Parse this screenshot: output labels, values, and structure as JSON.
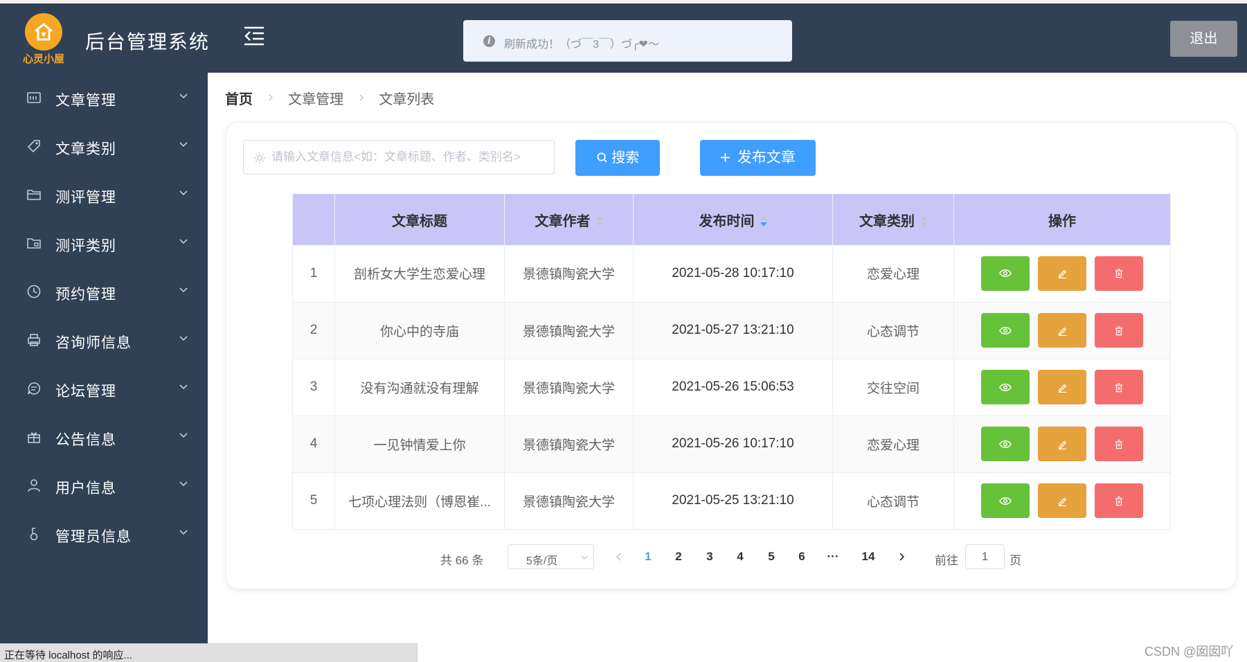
{
  "header": {
    "logo_text": "心灵小屋",
    "app_title": "后台管理系统",
    "toast_message": "刷新成功！（づ￣3￣）づ╭❤～",
    "logout_label": "退出"
  },
  "sidebar": {
    "items": [
      {
        "label": "文章管理",
        "icon": "article-icon"
      },
      {
        "label": "文章类别",
        "icon": "tag-icon"
      },
      {
        "label": "测评管理",
        "icon": "folder-icon"
      },
      {
        "label": "测评类别",
        "icon": "folder-icon"
      },
      {
        "label": "预约管理",
        "icon": "clock-icon"
      },
      {
        "label": "咨询师信息",
        "icon": "printer-icon"
      },
      {
        "label": "论坛管理",
        "icon": "chat-icon"
      },
      {
        "label": "公告信息",
        "icon": "gift-icon"
      },
      {
        "label": "用户信息",
        "icon": "user-icon"
      },
      {
        "label": "管理员信息",
        "icon": "admin-icon"
      }
    ]
  },
  "breadcrumb": [
    "首页",
    "文章管理",
    "文章列表"
  ],
  "toolbar": {
    "search_placeholder": "请输入文章信息<如：文章标题、作者、类别名>",
    "search_label": "搜索",
    "publish_label": "发布文章"
  },
  "table": {
    "headers": [
      "",
      "文章标题",
      "文章作者",
      "发布时间",
      "文章类别",
      "操作"
    ],
    "rows": [
      {
        "index": "1",
        "title": "剖析女大学生恋爱心理",
        "author": "景德镇陶瓷大学",
        "time": "2021-05-28 10:17:10",
        "category": "恋爱心理"
      },
      {
        "index": "2",
        "title": "你心中的寺庙",
        "author": "景德镇陶瓷大学",
        "time": "2021-05-27 13:21:10",
        "category": "心态调节"
      },
      {
        "index": "3",
        "title": "没有沟通就没有理解",
        "author": "景德镇陶瓷大学",
        "time": "2021-05-26 15:06:53",
        "category": "交往空间"
      },
      {
        "index": "4",
        "title": "一见钟情爱上你",
        "author": "景德镇陶瓷大学",
        "time": "2021-05-26 10:17:10",
        "category": "恋爱心理"
      },
      {
        "index": "5",
        "title": "七项心理法则（博恩崔...",
        "author": "景德镇陶瓷大学",
        "time": "2021-05-25 13:21:10",
        "category": "心态调节"
      }
    ]
  },
  "pagination": {
    "total": "共 66 条",
    "page_size": "5条/页",
    "pages": [
      "1",
      "2",
      "3",
      "4",
      "5",
      "6",
      "···",
      "14"
    ],
    "current_page": "1",
    "goto_label": "前往",
    "goto_value": "1",
    "page_unit": "页"
  },
  "status_bar": "正在等待 localhost 的响应...",
  "watermark": "CSDN @囡囡吖",
  "colors": {
    "sidebar_bg": "#304156",
    "primary": "#409eff",
    "table_header": "#c9c6f7",
    "view": "#67c23a",
    "edit": "#e6a23c",
    "delete": "#f56c6c"
  }
}
